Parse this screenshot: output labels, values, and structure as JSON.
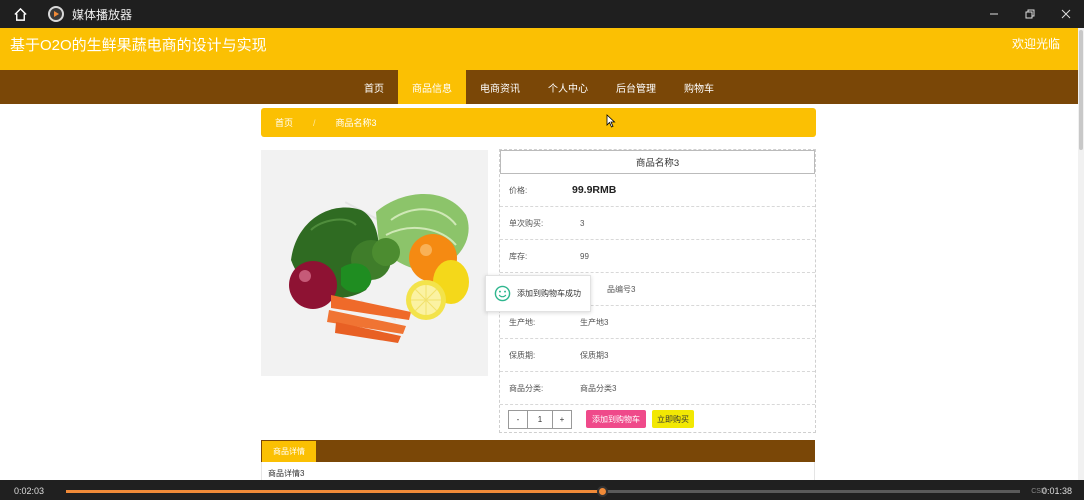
{
  "player": {
    "app_title": "媒体播放器",
    "current_time": "0:02:03",
    "total_time": "0:01:38",
    "progress_fraction": 0.562,
    "corner_mark": "CSD"
  },
  "site": {
    "title": "基于O2O的生鲜果蔬电商的设计与实现",
    "welcome": "欢迎光临"
  },
  "nav": {
    "items": [
      {
        "label": "首页",
        "active": false
      },
      {
        "label": "商品信息",
        "active": true
      },
      {
        "label": "电商资讯",
        "active": false
      },
      {
        "label": "个人中心",
        "active": false
      },
      {
        "label": "后台管理",
        "active": false
      },
      {
        "label": "购物车",
        "active": false
      }
    ]
  },
  "breadcrumb": {
    "home": "首页",
    "separator": "/",
    "current": "商品名称3"
  },
  "product": {
    "name": "商品名称3",
    "price_label": "价格:",
    "price_value": "99.9RMB",
    "per_order_label": "单次购买:",
    "per_order_value": "3",
    "stock_label": "库存:",
    "stock_value": "99",
    "code_value": "品编号3",
    "origin_label": "生产地:",
    "origin_value": "生产地3",
    "shelf_life_label": "保质期:",
    "shelf_life_value": "保质期3",
    "category_label": "商品分类:",
    "category_value": "商品分类3",
    "qty_minus": "-",
    "qty_value": "1",
    "qty_plus": "+",
    "add_to_cart": "添加到购物车",
    "buy_now": "立即购买"
  },
  "toast": {
    "message": "添加到购物车成功"
  },
  "details": {
    "tab_label": "商品详情",
    "body": "商品详情3"
  },
  "colors": {
    "accent": "#fbc003",
    "nav_bg": "#7a4707",
    "cart_button": "#ef4a8a",
    "buy_button": "#f2e803",
    "progress": "#f08a38"
  }
}
